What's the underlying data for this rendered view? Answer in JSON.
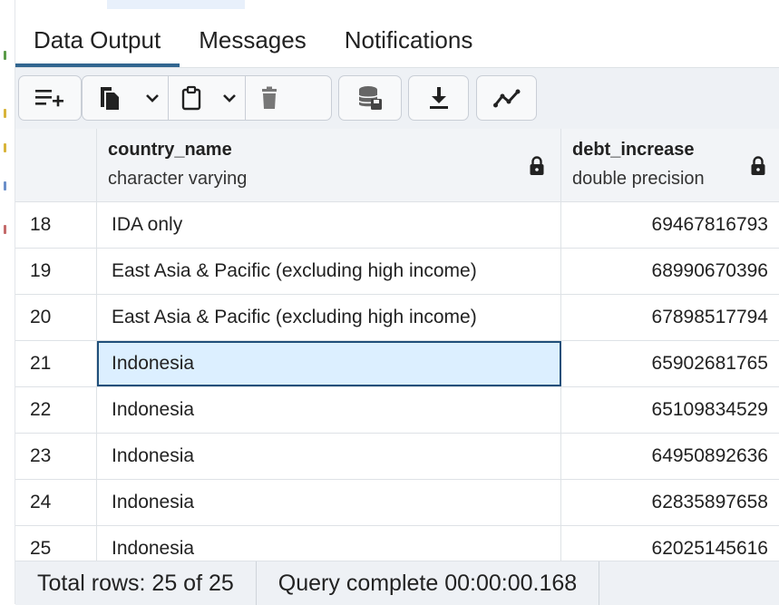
{
  "tabs": [
    {
      "label": "Data Output",
      "active": true
    },
    {
      "label": "Messages",
      "active": false
    },
    {
      "label": "Notifications",
      "active": false
    }
  ],
  "toolbar": {
    "icons": [
      "add-row-icon",
      "copy-icon",
      "chevron-down-icon",
      "paste-icon",
      "chevron-down-icon",
      "delete-icon",
      "save-data-icon",
      "download-icon",
      "graph-icon"
    ]
  },
  "columns": [
    {
      "name": "",
      "type": ""
    },
    {
      "name": "country_name",
      "type": "character varying"
    },
    {
      "name": "debt_increase",
      "type": "double precision"
    }
  ],
  "rows": [
    {
      "num": "18",
      "country": "IDA only",
      "debt": "69467816793"
    },
    {
      "num": "19",
      "country": "East Asia & Pacific (excluding high income)",
      "debt": "68990670396"
    },
    {
      "num": "20",
      "country": "East Asia & Pacific (excluding high income)",
      "debt": "67898517794"
    },
    {
      "num": "21",
      "country": "Indonesia",
      "debt": "65902681765"
    },
    {
      "num": "22",
      "country": "Indonesia",
      "debt": "65109834529"
    },
    {
      "num": "23",
      "country": "Indonesia",
      "debt": "64950892636"
    },
    {
      "num": "24",
      "country": "Indonesia",
      "debt": "62835897658"
    },
    {
      "num": "25",
      "country": "Indonesia",
      "debt": "62025145616"
    }
  ],
  "selected_cell": {
    "row": 3,
    "column": "country_name"
  },
  "status": {
    "total_rows": "Total rows: 25 of 25",
    "query": "Query complete 00:00:00.168"
  },
  "colors": {
    "accent": "#326690",
    "selection": "#dcefff",
    "selection_border": "#1f4f7a",
    "toolbar_bg": "#eef1f5"
  }
}
